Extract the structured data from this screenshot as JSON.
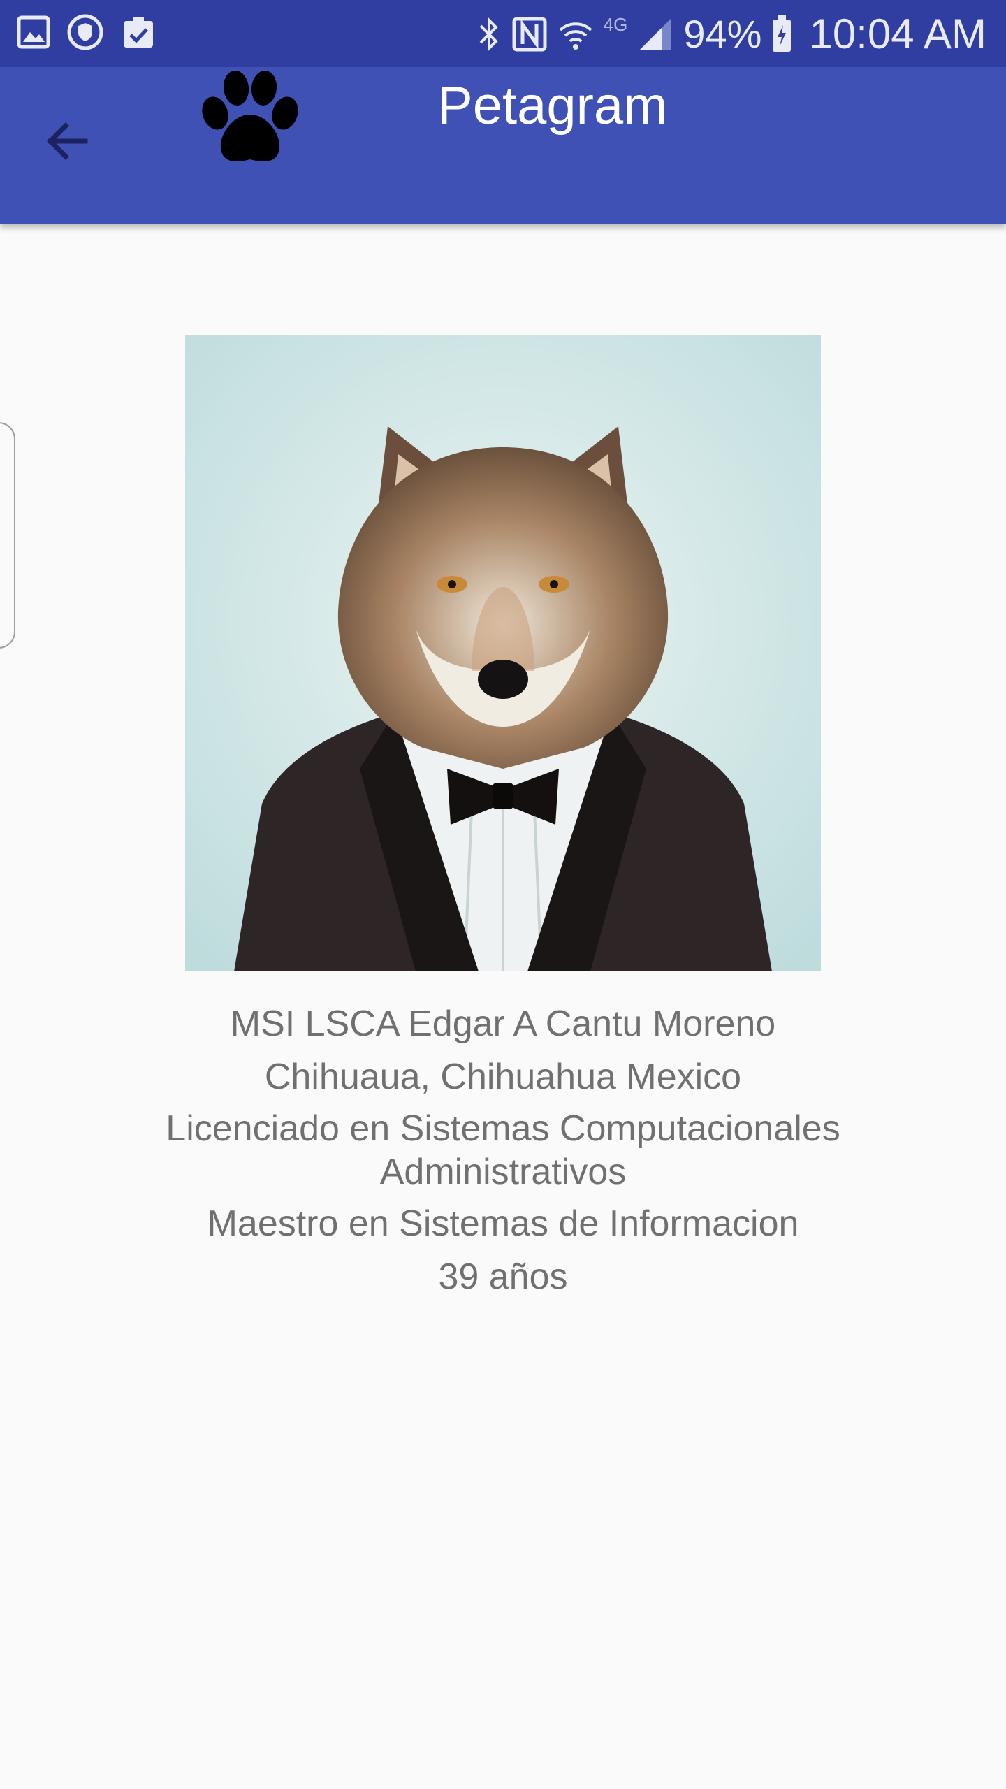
{
  "status_bar": {
    "battery_percent": "94%",
    "time": "10:04 AM",
    "network_label": "4G",
    "icons": [
      "gallery-icon",
      "shield-icon",
      "clipboard-icon",
      "bluetooth-icon",
      "nfc-icon",
      "wifi-icon",
      "signal-icon",
      "battery-charging-icon"
    ]
  },
  "app_bar": {
    "title": "Petagram",
    "back_icon": "arrow-left-icon",
    "logo_icon": "paw-icon",
    "color": "#3f51b5"
  },
  "profile": {
    "photo": "wolf-in-tuxedo-portrait",
    "name": "MSI LSCA Edgar A Cantu Moreno",
    "location": "Chihuaua, Chihuahua Mexico",
    "degree": "Licenciado en Sistemas Computacionales Administrativos",
    "masters": "Maestro en Sistemas de Informacion",
    "age": "39 años"
  }
}
